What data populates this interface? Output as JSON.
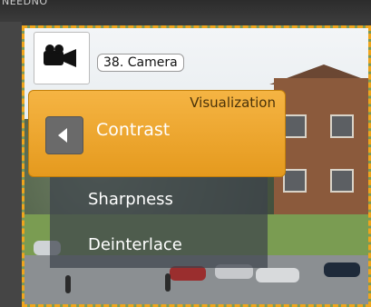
{
  "window": {
    "top_label": "NEEDNO"
  },
  "camera": {
    "title": "38. Camera",
    "icon": "video-camera-icon"
  },
  "menu": {
    "section_label": "Visualization",
    "active_item": "Contrast",
    "items": [
      "Sharpness",
      "Deinterlace"
    ]
  },
  "colors": {
    "accent": "#f0a51c",
    "menu_dark": "#3c414b"
  }
}
